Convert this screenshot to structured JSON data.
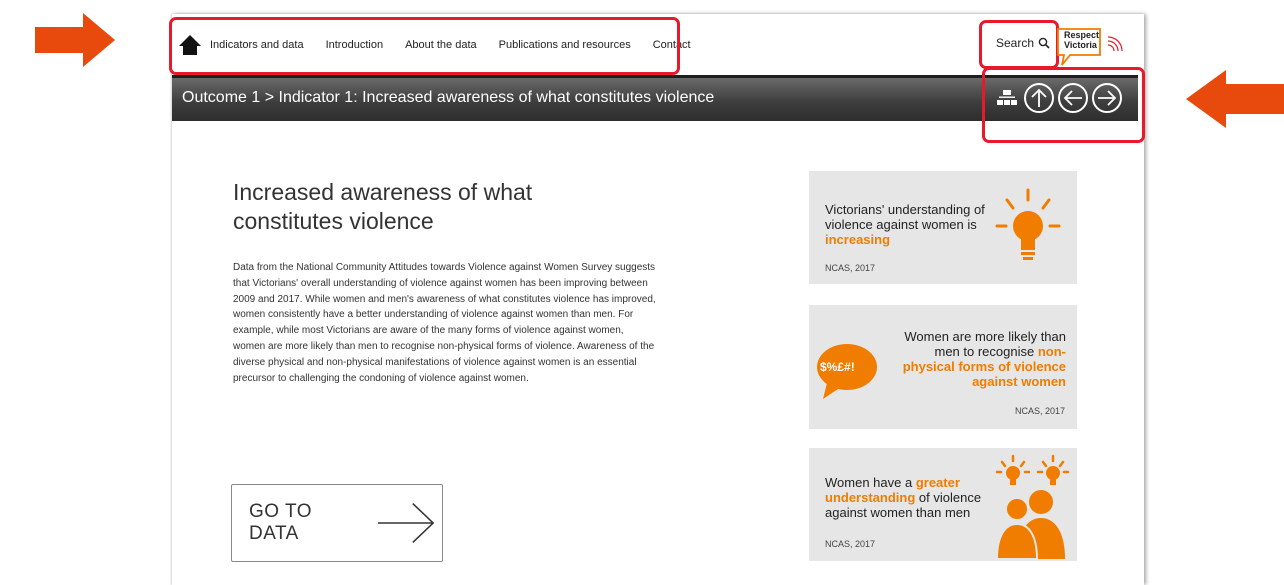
{
  "nav": {
    "items": [
      "Indicators and data",
      "Introduction",
      "About the data",
      "Publications and resources",
      "Contact"
    ]
  },
  "search": {
    "label": "Search"
  },
  "logo": {
    "line1": "Respect",
    "line2": "Victoria"
  },
  "titlebar": {
    "title": "Outcome 1 > Indicator 1: Increased awareness of what constitutes violence"
  },
  "main": {
    "title": "Increased awareness of what constitutes violence",
    "body": "Data from the National Community Attitudes towards Violence against Women Survey suggests that Victorians' overall understanding of violence against women has been improving between 2009 and 2017. While women and men's awareness of what constitutes violence has improved, women consistently have a better understanding of violence against women than men. For example, while most Victorians are aware of the many forms of violence against women, women are more likely than men to recognise non-physical forms of violence. Awareness of the diverse physical and non-physical manifestations of violence against women is an essential precursor to challenging the condoning of violence against women.",
    "goto_label": "GO TO DATA"
  },
  "cards": [
    {
      "text": "Victorians' understanding of violence against women is",
      "highlight": "increasing",
      "source": "NCAS, 2017"
    },
    {
      "text": "Women are more likely than men to recognise",
      "highlight": "non-physical forms of violence against women",
      "source": "NCAS, 2017",
      "bubble": "$%£#!"
    },
    {
      "text_before": "Women have a",
      "highlight": "greater understanding",
      "text_after": "of violence against women than men",
      "source": "NCAS, 2017"
    }
  ],
  "colors": {
    "accent": "#f07c00",
    "annotation": "#e8192c",
    "arrow": "#e84a0e",
    "titlebar": "#3e3e3e"
  }
}
